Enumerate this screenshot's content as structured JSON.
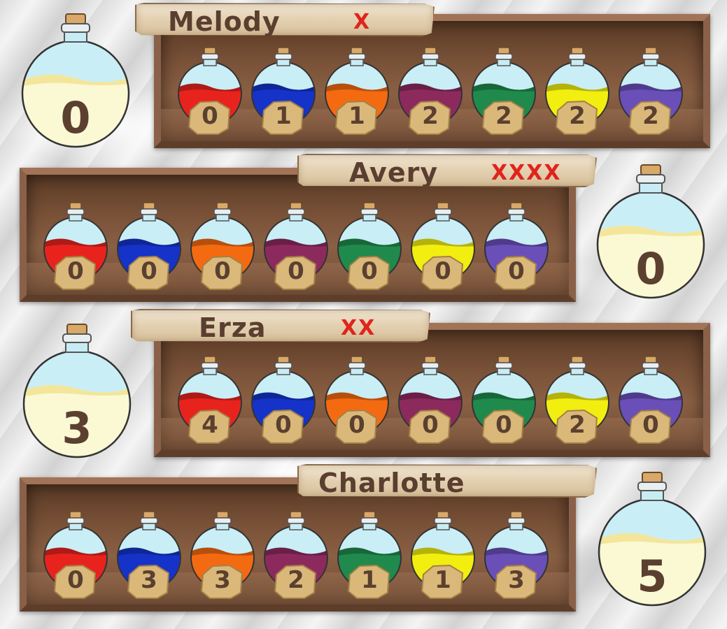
{
  "potion_colors": [
    "#e8231e",
    "#1533c9",
    "#f46a11",
    "#8c2a5e",
    "#1f8a4c",
    "#f2ee10",
    "#6a4fb8"
  ],
  "players": [
    {
      "name": "Melody",
      "strikes": "X",
      "score": "0",
      "potions": [
        "0",
        "1",
        "1",
        "2",
        "2",
        "2",
        "2"
      ]
    },
    {
      "name": "Avery",
      "strikes": "XXXX",
      "score": "0",
      "potions": [
        "0",
        "0",
        "0",
        "0",
        "0",
        "0",
        "0"
      ]
    },
    {
      "name": "Erza",
      "strikes": "XX",
      "score": "3",
      "potions": [
        "4",
        "0",
        "0",
        "0",
        "0",
        "2",
        "0"
      ]
    },
    {
      "name": "Charlotte",
      "strikes": "",
      "score": "5",
      "potions": [
        "0",
        "3",
        "3",
        "2",
        "1",
        "1",
        "3"
      ]
    }
  ]
}
